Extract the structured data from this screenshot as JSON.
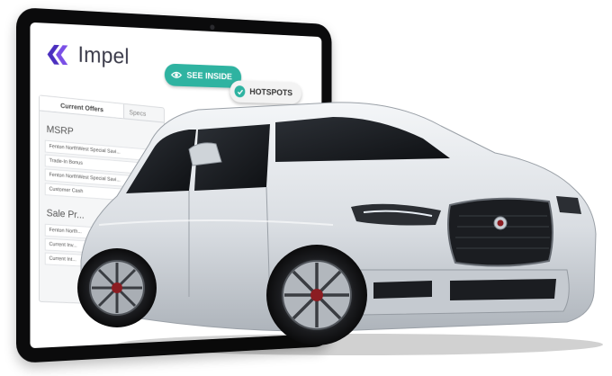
{
  "brand": {
    "name": "Impel",
    "accent_color": "#5a3fd0",
    "teal_color": "#2fb3a1"
  },
  "toolbar": {
    "see_inside_label": "SEE INSIDE",
    "hotspots_label": "HOTSPOTS"
  },
  "panel": {
    "tabs": [
      {
        "label": "Current Offers"
      },
      {
        "label": "Specs"
      }
    ],
    "msrp": {
      "title": "MSRP",
      "rows": [
        "Fenton NorthWest Special Savi...",
        "Trade-In Bonus",
        "Fenton NorthWest Special Savi...",
        "Customer Cash"
      ]
    },
    "sale_price": {
      "title": "Sale Pr...",
      "rows": [
        "Fenton North...",
        "Current Inv...",
        "Current Int..."
      ]
    }
  },
  "icons": {
    "logo": "impel-chevron-icon",
    "see_inside": "eye-icon",
    "hotspots": "check-circle-icon"
  }
}
